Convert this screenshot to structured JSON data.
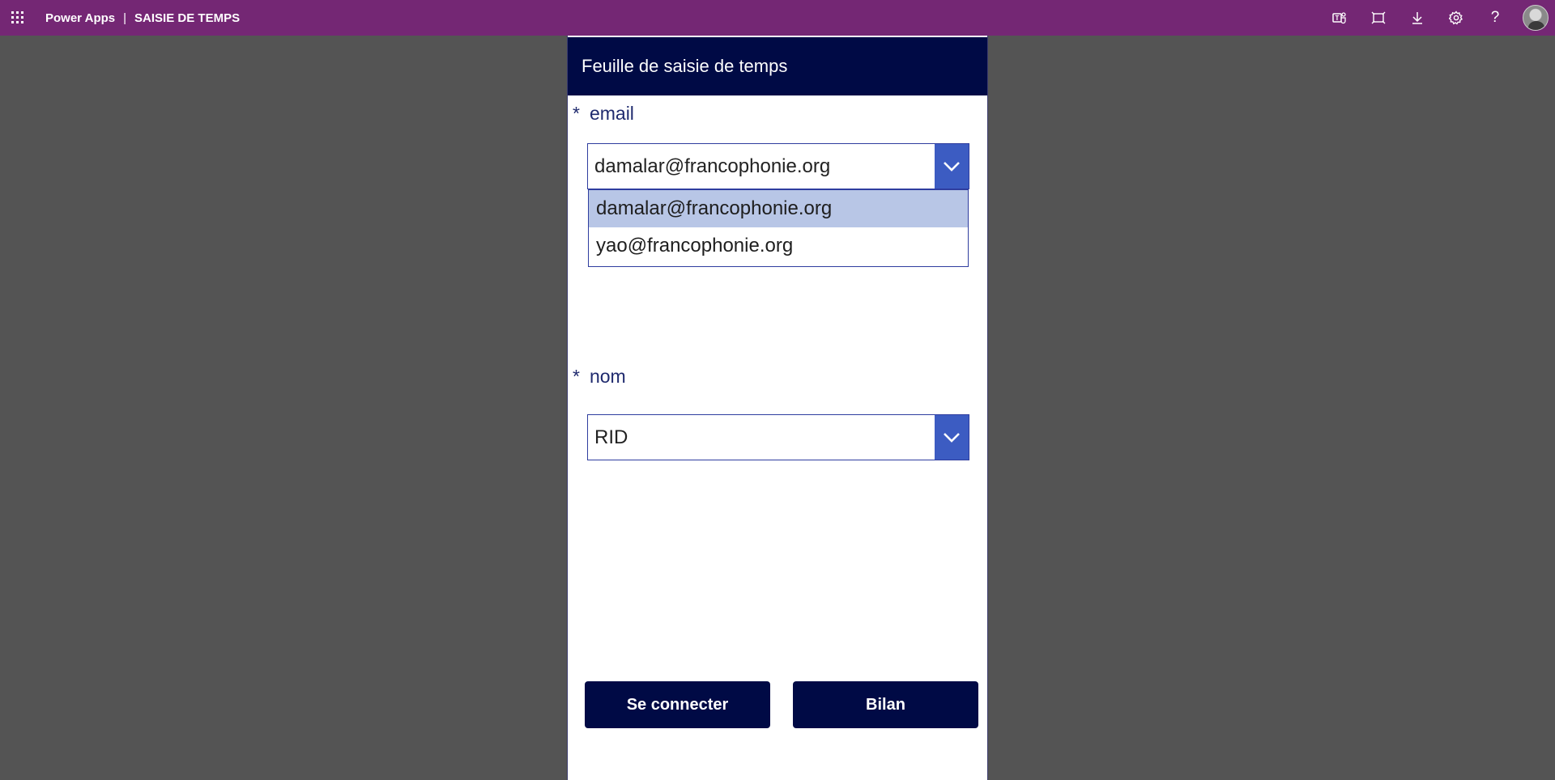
{
  "topbar": {
    "brand": "Power Apps",
    "separator": "|",
    "app_name": "SAISIE DE TEMPS",
    "icons": [
      "teams-icon",
      "fit-to-window-icon",
      "download-icon",
      "settings-icon",
      "help-icon"
    ],
    "help_glyph": "?"
  },
  "screen": {
    "title": "Feuille de saisie de temps",
    "header_color": "#000a45"
  },
  "email_field": {
    "required_mark": "*",
    "label": "email",
    "value": "damalar@francophonie.org",
    "options": [
      "damalar@francophonie.org",
      "yao@francophonie.org"
    ],
    "selected_index": 0
  },
  "nom_field": {
    "required_mark": "*",
    "label": "nom",
    "value": "RID"
  },
  "buttons": {
    "connect_label": "Se connecter",
    "bilan_label": "Bilan"
  },
  "colors": {
    "topbar": "#742774",
    "accent": "#3c5cc2",
    "selected_option": "#b8c6e6",
    "background": "#545454"
  }
}
